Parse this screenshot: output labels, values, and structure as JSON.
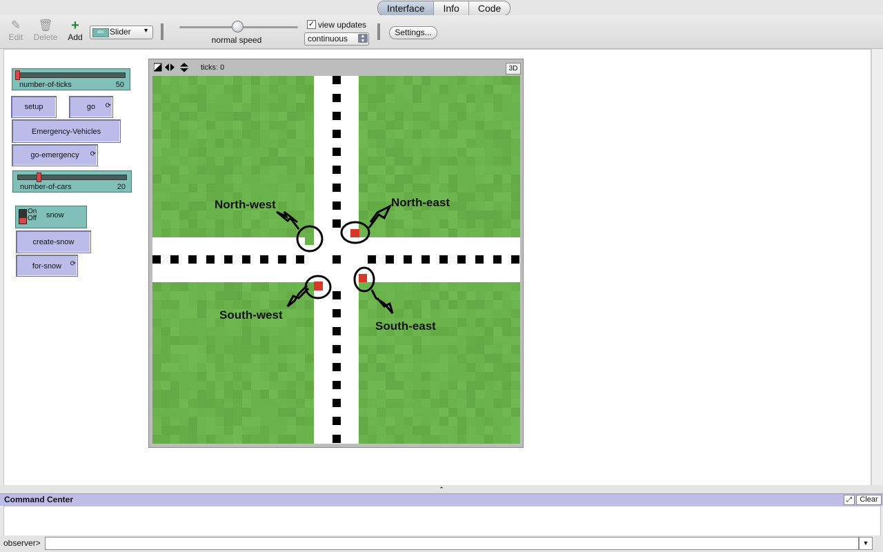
{
  "tabs": [
    "Interface",
    "Info",
    "Code"
  ],
  "toolbar": {
    "edit_label": "Edit",
    "delete_label": "Delete",
    "add_label": "Add",
    "widget_type": "Slider",
    "speed_label": "normal speed",
    "speed_fraction": 0.5,
    "view_updates_label": "view updates",
    "view_updates_checked": true,
    "update_mode": "continuous",
    "settings_label": "Settings..."
  },
  "widgets": {
    "number_of_ticks": {
      "name": "number-of-ticks",
      "value": "50"
    },
    "setup": "setup",
    "go": "go",
    "emergency_vehicles": "Emergency-Vehicles",
    "go_emergency": "go-emergency",
    "number_of_cars": {
      "name": "number-of-cars",
      "value": "20"
    },
    "snow_switch": {
      "on": "On",
      "off": "Off",
      "name": "snow"
    },
    "create_snow": "create-snow",
    "for_snow": "for-snow"
  },
  "view": {
    "ticks_label": "ticks: 0",
    "btn_3d": "3D",
    "annotations": {
      "north_west": "North-west",
      "north_east": "North-east",
      "south_west": "South-west",
      "south_east": "South-east"
    }
  },
  "command_center": {
    "title": "Command Center",
    "clear": "Clear",
    "prompt": "observer>",
    "input": ""
  },
  "colors": {
    "grass": "#6ab24c",
    "road": "#ffffff",
    "car": "#d43a2a",
    "slider": "#80c0b8",
    "button": "#bcbcea"
  },
  "icons": [
    "pencil-icon",
    "trash-icon",
    "plus-icon",
    "forever-icon",
    "expand-icon"
  ]
}
